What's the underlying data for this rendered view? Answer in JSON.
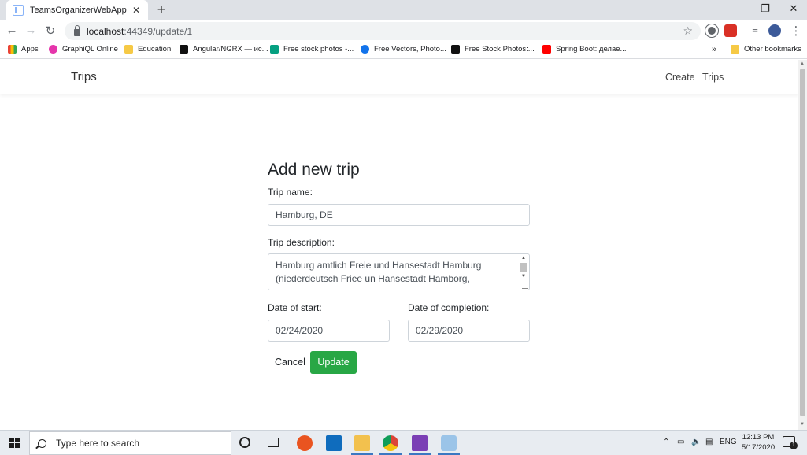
{
  "browser": {
    "tab_title": "TeamsOrganizerWebApp",
    "tab_close": "✕",
    "new_tab": "+",
    "window_controls": {
      "minimize": "—",
      "restore": "❐",
      "close": "✕"
    },
    "url_host": "localhost",
    "url_path": ":44349/update/1",
    "bookmarks": [
      {
        "label": "Apps",
        "icon_color": "#ea4335"
      },
      {
        "label": "GraphiQL Online",
        "icon_color": "#e535ab"
      },
      {
        "label": "Education",
        "icon_color": "#f6c945"
      },
      {
        "label": "Angular/NGRX — ис...",
        "icon_color": "#111111"
      },
      {
        "label": "Free stock photos -...",
        "icon_color": "#05a081"
      },
      {
        "label": "Free Vectors, Photo...",
        "icon_color": "#1273eb"
      },
      {
        "label": "Free Stock Photos:...",
        "icon_color": "#111111"
      },
      {
        "label": "Spring Boot: делае...",
        "icon_color": "#ff0000"
      }
    ],
    "bookmarks_more": "»",
    "other_bookmarks": "Other bookmarks"
  },
  "navbar": {
    "brand": "Trips",
    "links": [
      "Create",
      "Trips"
    ]
  },
  "form": {
    "title": "Add new trip",
    "trip_name_label": "Trip name:",
    "trip_name_value": "Hamburg, DE",
    "trip_description_label": "Trip description:",
    "trip_description_line1": "Hamburg amtlich Freie und Hansestadt Hamburg",
    "trip_description_line2": "(niederdeutsch Friee un Hansestadt Hamborg,",
    "date_start_label": "Date of start:",
    "date_start_value": "02/24/2020",
    "date_completion_label": "Date of completion:",
    "date_completion_value": "02/29/2020",
    "cancel_label": "Cancel",
    "update_label": "Update"
  },
  "taskbar": {
    "search_placeholder": "Type here to search",
    "language": "ENG",
    "time": "12:13 PM",
    "date": "5/17/2020",
    "notification_count": "1"
  },
  "colors": {
    "update_button": "#28a745",
    "tab_strip": "#dee1e6",
    "taskbar": "#e8ecf1"
  }
}
